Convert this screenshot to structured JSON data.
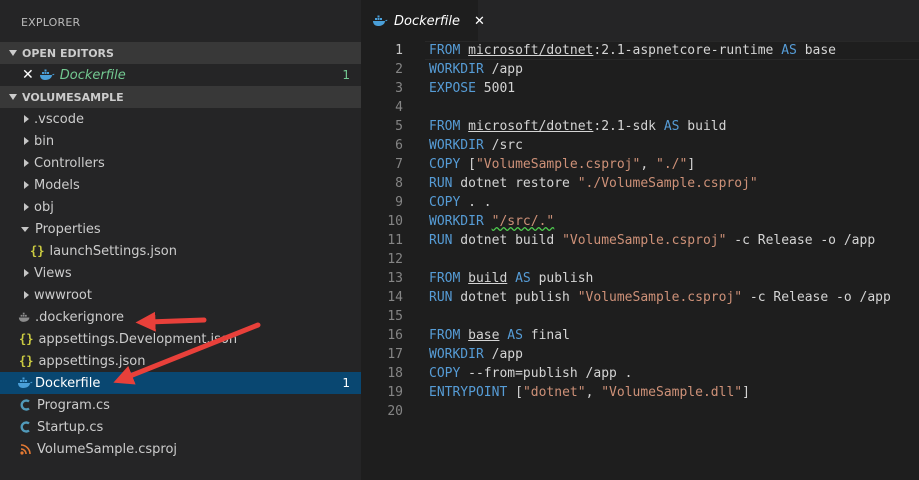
{
  "sidebar": {
    "title": "EXPLORER",
    "open_editors": {
      "header": "OPEN EDITORS",
      "items": [
        {
          "label": "Dockerfile",
          "badge": "1",
          "close": "✕"
        }
      ]
    },
    "project": {
      "header": "VOLUMESAMPLE",
      "items": [
        {
          "label": ".vscode"
        },
        {
          "label": "bin"
        },
        {
          "label": "Controllers"
        },
        {
          "label": "Models"
        },
        {
          "label": "obj"
        },
        {
          "label": "Properties"
        },
        {
          "label": "launchSettings.json"
        },
        {
          "label": "Views"
        },
        {
          "label": "wwwroot"
        },
        {
          "label": ".dockerignore"
        },
        {
          "label": "appsettings.Development.json"
        },
        {
          "label": "appsettings.json"
        },
        {
          "label": "Dockerfile",
          "badge": "1"
        },
        {
          "label": "Program.cs"
        },
        {
          "label": "Startup.cs"
        },
        {
          "label": "VolumeSample.csproj"
        }
      ]
    }
  },
  "editor": {
    "tab": {
      "label": "Dockerfile",
      "close": "✕"
    },
    "lines": [
      {
        "n": "1",
        "segs": [
          [
            "kw",
            "FROM"
          ],
          [
            "t",
            " "
          ],
          [
            "ul",
            "microsoft/dotnet"
          ],
          [
            "t",
            ":2.1-aspnetcore-runtime "
          ],
          [
            "kw",
            "AS"
          ],
          [
            "t",
            " base"
          ]
        ]
      },
      {
        "n": "2",
        "segs": [
          [
            "kw",
            "WORKDIR"
          ],
          [
            "t",
            " /app"
          ]
        ]
      },
      {
        "n": "3",
        "segs": [
          [
            "kw",
            "EXPOSE"
          ],
          [
            "t",
            " 5001"
          ]
        ]
      },
      {
        "n": "4",
        "segs": []
      },
      {
        "n": "5",
        "segs": [
          [
            "kw",
            "FROM"
          ],
          [
            "t",
            " "
          ],
          [
            "ul",
            "microsoft/dotnet"
          ],
          [
            "t",
            ":2.1-sdk "
          ],
          [
            "kw",
            "AS"
          ],
          [
            "t",
            " build"
          ]
        ]
      },
      {
        "n": "6",
        "segs": [
          [
            "kw",
            "WORKDIR"
          ],
          [
            "t",
            " /src"
          ]
        ]
      },
      {
        "n": "7",
        "segs": [
          [
            "kw",
            "COPY"
          ],
          [
            "t",
            " ["
          ],
          [
            "str",
            "\"VolumeSample.csproj\""
          ],
          [
            "t",
            ", "
          ],
          [
            "str",
            "\"./\""
          ],
          [
            "t",
            "]"
          ]
        ]
      },
      {
        "n": "8",
        "segs": [
          [
            "kw",
            "RUN"
          ],
          [
            "t",
            " dotnet restore "
          ],
          [
            "str",
            "\"./VolumeSample.csproj\""
          ]
        ]
      },
      {
        "n": "9",
        "segs": [
          [
            "kw",
            "COPY"
          ],
          [
            "t",
            " . ."
          ]
        ]
      },
      {
        "n": "10",
        "segs": [
          [
            "kw",
            "WORKDIR"
          ],
          [
            "t",
            " "
          ],
          [
            "squig",
            "\"/src/.\""
          ]
        ]
      },
      {
        "n": "11",
        "segs": [
          [
            "kw",
            "RUN"
          ],
          [
            "t",
            " dotnet build "
          ],
          [
            "str",
            "\"VolumeSample.csproj\""
          ],
          [
            "t",
            " -c Release -o /app"
          ]
        ]
      },
      {
        "n": "12",
        "segs": []
      },
      {
        "n": "13",
        "segs": [
          [
            "kw",
            "FROM"
          ],
          [
            "t",
            " "
          ],
          [
            "ul",
            "build"
          ],
          [
            "t",
            " "
          ],
          [
            "kw",
            "AS"
          ],
          [
            "t",
            " publish"
          ]
        ]
      },
      {
        "n": "14",
        "segs": [
          [
            "kw",
            "RUN"
          ],
          [
            "t",
            " dotnet publish "
          ],
          [
            "str",
            "\"VolumeSample.csproj\""
          ],
          [
            "t",
            " -c Release -o /app"
          ]
        ]
      },
      {
        "n": "15",
        "segs": []
      },
      {
        "n": "16",
        "segs": [
          [
            "kw",
            "FROM"
          ],
          [
            "t",
            " "
          ],
          [
            "ul",
            "base"
          ],
          [
            "t",
            " "
          ],
          [
            "kw",
            "AS"
          ],
          [
            "t",
            " final"
          ]
        ]
      },
      {
        "n": "17",
        "segs": [
          [
            "kw",
            "WORKDIR"
          ],
          [
            "t",
            " /app"
          ]
        ]
      },
      {
        "n": "18",
        "segs": [
          [
            "kw",
            "COPY"
          ],
          [
            "t",
            " --from=publish /app ."
          ]
        ]
      },
      {
        "n": "19",
        "segs": [
          [
            "kw",
            "ENTRYPOINT"
          ],
          [
            "t",
            " ["
          ],
          [
            "str",
            "\"dotnet\""
          ],
          [
            "t",
            ", "
          ],
          [
            "str",
            "\"VolumeSample.dll\""
          ],
          [
            "t",
            "]"
          ]
        ]
      },
      {
        "n": "20",
        "segs": []
      }
    ]
  },
  "colors": {
    "sidebar_bg": "#252526",
    "editor_bg": "#1e1e1e",
    "selection": "#094771",
    "keyword": "#569cd6",
    "string": "#ce9178",
    "modified": "#73c991",
    "arrow": "#e8403a"
  },
  "icons": {
    "docker": "docker-whale-icon",
    "json": "json-braces-icon",
    "csharp": "csharp-icon",
    "rss": "msbuild-rss-icon"
  }
}
